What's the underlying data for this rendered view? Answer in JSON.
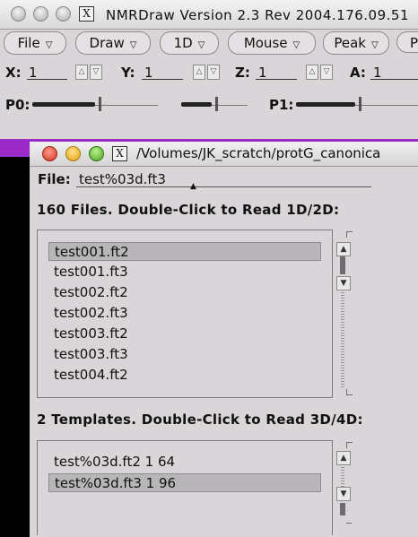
{
  "main_window": {
    "title": "NMRDraw Version 2.3 Rev 2004.176.09.51",
    "menus": [
      {
        "label": "File"
      },
      {
        "label": "Draw"
      },
      {
        "label": "1D"
      },
      {
        "label": "Mouse"
      },
      {
        "label": "Peak"
      },
      {
        "label": "P"
      }
    ],
    "coords": {
      "x_label": "X:",
      "x_value": "1",
      "y_label": "Y:",
      "y_value": "1",
      "z_label": "Z:",
      "z_value": "1",
      "a_label": "A:",
      "a_value": "1"
    },
    "phase": {
      "p0_label": "P0:",
      "p1_label": "P1:"
    }
  },
  "file_dialog": {
    "title_path": "/Volumes/JK_scratch/protG_canonica",
    "file_label": "File:",
    "file_value": "test%03d.ft3",
    "files_heading": "160 Files.  Double-Click to Read 1D/2D:",
    "files": [
      "test001.ft2",
      "test001.ft3",
      "test002.ft2",
      "test002.ft3",
      "test003.ft2",
      "test003.ft3",
      "test004.ft2"
    ],
    "templates_heading": "2 Templates.  Double-Click to Read 3D/4D:",
    "templates": [
      "test%03d.ft2 1 64",
      "test%03d.ft3 1 96"
    ]
  },
  "colors": {
    "desktop_accent": "#9a2bc8",
    "close": "#d1321c",
    "minimize": "#e0a110",
    "zoom": "#4ba320"
  }
}
